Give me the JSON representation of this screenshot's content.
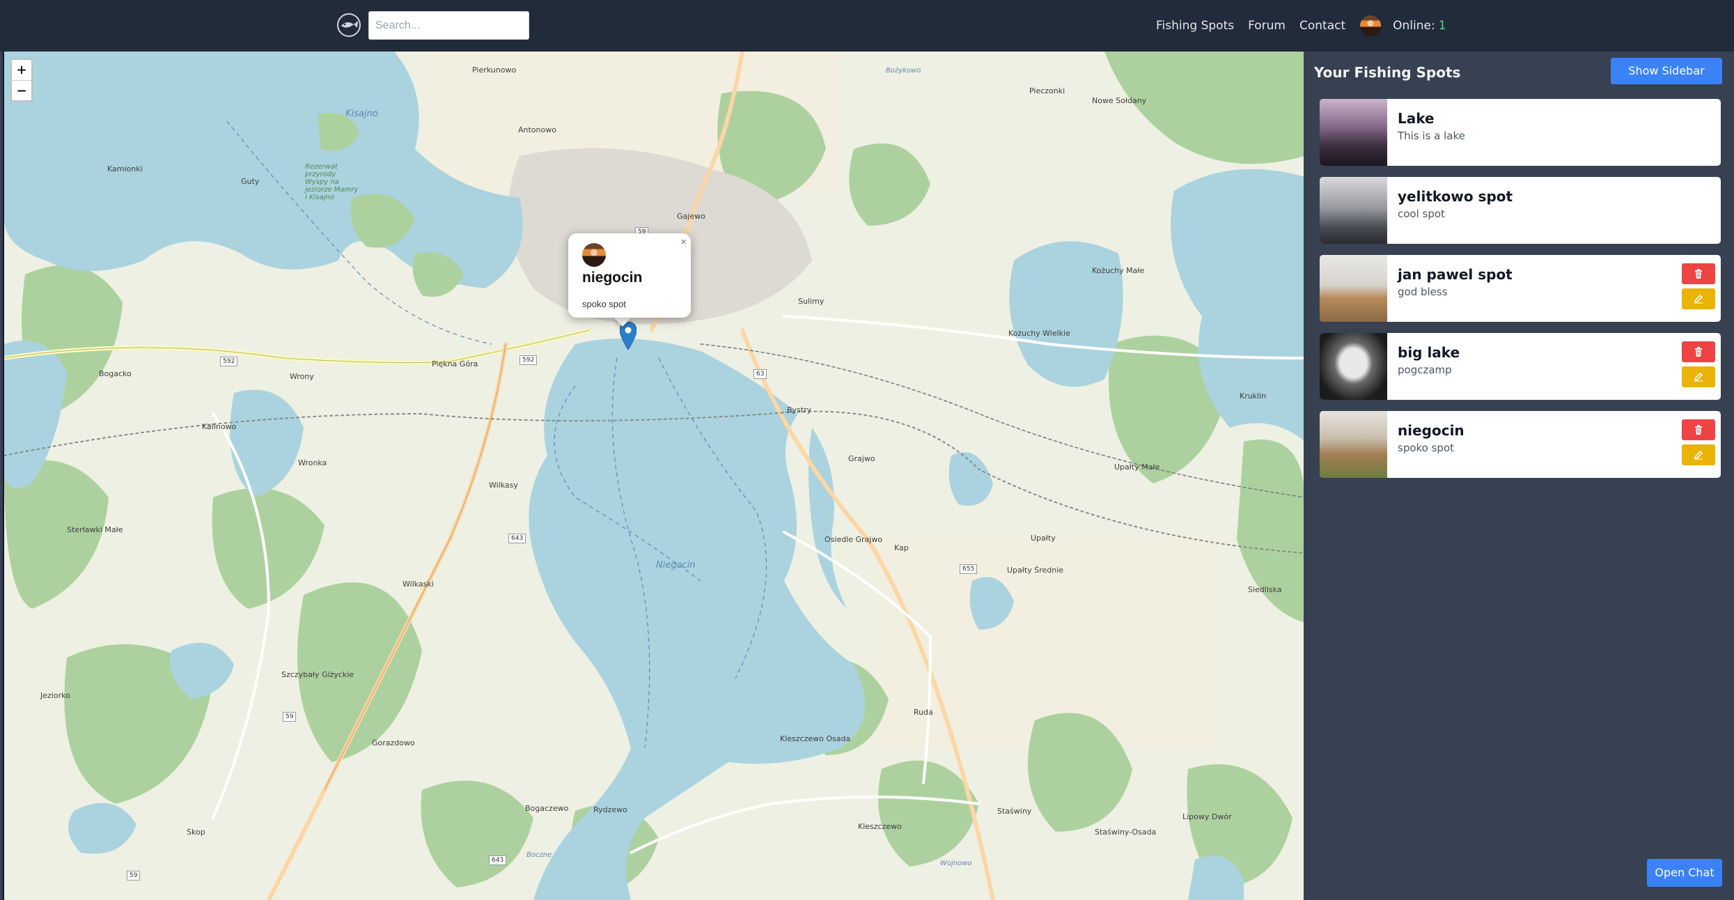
{
  "navbar": {
    "search_placeholder": "Search...",
    "links": [
      "Fishing Spots",
      "Forum",
      "Contact"
    ],
    "online_label": "Online:",
    "online_count": "1"
  },
  "map": {
    "zoom_in": "+",
    "zoom_out": "−",
    "labels": {
      "pierkunowo": "Pierkunowo",
      "antonowo": "Antonowo",
      "kamionki": "Kamionki",
      "guty": "Guty",
      "kisajno": "Kisajno",
      "rezerwat": "Rezerwat przyrody Wyspy na jeziorze Mamry i Kisajno",
      "gajewo": "Gajewo",
      "sulimy": "Sulimy",
      "bogacko": "Bogacko",
      "wrony": "Wrony",
      "piekna_gora": "Piękna Góra",
      "kalinowo": "Kalinowo",
      "wronka": "Wronka",
      "wilkasy": "Wilkasy",
      "sterlawki": "Sterławki Małe",
      "wilkaski": "Wilkaski",
      "niegocin": "Niegocin",
      "bystry": "Bystry",
      "grajwo": "Grajwo",
      "osiedle_grajwo": "Osiedle Grajwo",
      "kap": "Kap",
      "kozuchy_male": "Kożuchy Małe",
      "kozuchy_wielkie": "Kożuchy Wielkie",
      "pieczonki": "Pieczonki",
      "nowe_soldany": "Nowe Sołdany",
      "kruklin": "Kruklin",
      "upalty_male": "Upałty Małe",
      "upalty": "Upałty",
      "upalty_srednie": "Upałty Średnie",
      "siedliska": "Siedliska",
      "szczybaly": "Szczybały Giżyckie",
      "jeziorko": "Jeziorko",
      "gorazdowo": "Gorazdowo",
      "skop": "Skop",
      "bogaczewo": "Bogaczewo",
      "rydzewo": "Rydzewo",
      "kleszczewo_osada": "Kleszczewo Osada",
      "kleszczewo": "Kleszczewo",
      "ruda": "Ruda",
      "stawiny": "Staświny",
      "stawiny_osada": "Staświny-Osada",
      "lipowy_dwor": "Lipowy Dwór",
      "bozykowo": "Bożykowo",
      "wojnowo": "Wojnowo",
      "boczne": "Boczne"
    },
    "roads": [
      "59",
      "592",
      "592",
      "63",
      "643",
      "655",
      "59",
      "643",
      "59"
    ]
  },
  "popup": {
    "title": "niegocin",
    "description": "spoko spot",
    "close": "×"
  },
  "sidebar": {
    "title": "Your Fishing Spots",
    "show_sidebar": "Show Sidebar",
    "open_chat": "Open Chat",
    "spots": [
      {
        "title": "Lake",
        "description": "This is a lake",
        "editable": false
      },
      {
        "title": "yelitkowo spot",
        "description": "cool spot",
        "editable": false
      },
      {
        "title": "jan pawel spot",
        "description": "god bless",
        "editable": true
      },
      {
        "title": "big lake",
        "description": "pogczamp",
        "editable": true
      },
      {
        "title": "niegocin",
        "description": "spoko spot",
        "editable": true
      }
    ]
  },
  "colors": {
    "navbar_bg": "#222b3a",
    "sidebar_bg": "#374151",
    "primary": "#3b82f6",
    "danger": "#ef4444",
    "warning": "#eab308",
    "online": "#4ade80",
    "water": "#aad3df",
    "forest": "#add19e"
  }
}
